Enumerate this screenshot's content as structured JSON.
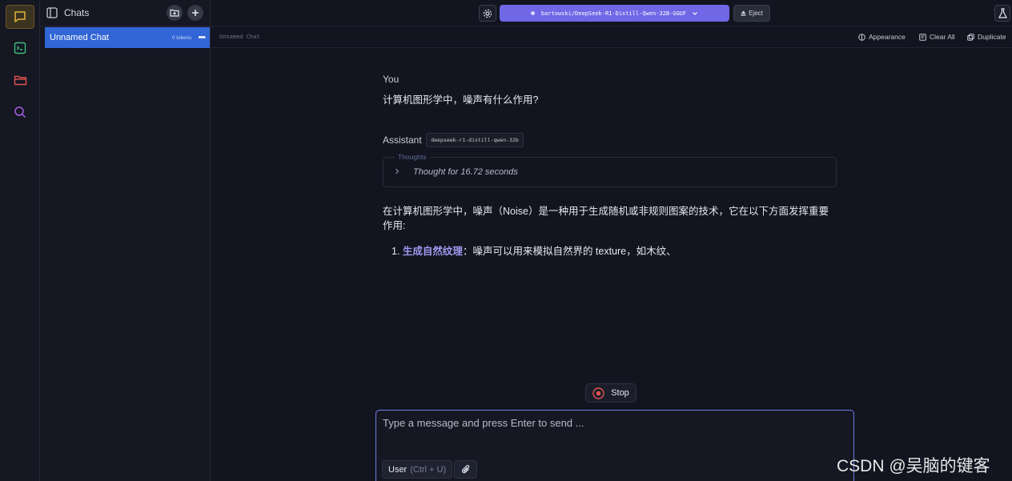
{
  "sidebar": {
    "title": "Chats",
    "chats": [
      {
        "name": "Unnamed Chat",
        "tokens": "0 tokens"
      }
    ]
  },
  "topbar": {
    "model": "bartowski/DeepSeek-R1-Distill-Qwen-32B-GGUF",
    "eject_label": "Eject"
  },
  "subbar": {
    "chat_name": "Unnamed Chat",
    "appearance": "Appearance",
    "clear_all": "Clear All",
    "duplicate": "Duplicate"
  },
  "conversation": {
    "user_role": "You",
    "user_message": "计算机图形学中，噪声有什么作用?",
    "assistant_role": "Assistant",
    "assistant_model": "deepseek-r1-distill-qwen-32b",
    "thoughts_label": "Thoughts",
    "thoughts_summary": "Thought for 16.72 seconds",
    "answer_intro": "在计算机图形学中，噪声（Noise）是一种用于生成随机或非规则图案的技术，它在以下方面发挥重要作用:",
    "answer_item_number": "1.",
    "answer_item_title": "生成自然纹理",
    "answer_item_text": "：噪声可以用来模拟自然界的 texture，如木纹、"
  },
  "stop_label": "Stop",
  "composer": {
    "placeholder": "Type a message and press Enter to send ...",
    "role_label": "User",
    "role_hint": "(Ctrl + U)"
  },
  "watermark": "CSDN @吴脑的键客",
  "icons": [
    "chat-icon",
    "terminal-icon",
    "folder-icon",
    "search-icon",
    "sidebar-toggle-icon",
    "new-folder-icon",
    "plus-icon",
    "gear-icon",
    "chevron-down-icon",
    "eject-icon",
    "flask-icon",
    "appearance-icon",
    "clear-icon",
    "duplicate-icon",
    "chevron-right-icon",
    "stop-icon",
    "paperclip-icon"
  ],
  "colors": {
    "accent": "#6f67e6",
    "selected_chat": "#3266d6",
    "rail_active": "#e6b53a"
  }
}
